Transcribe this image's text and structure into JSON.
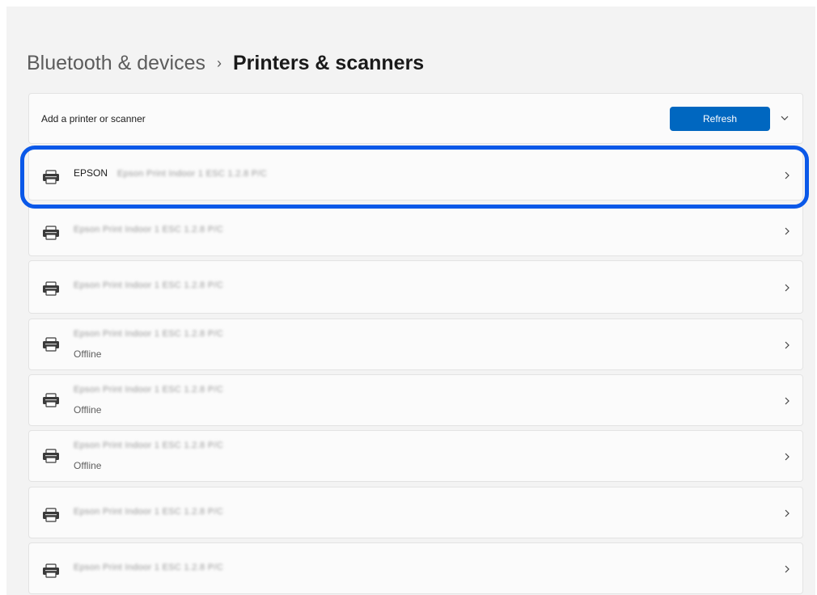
{
  "breadcrumb": {
    "parent": "Bluetooth & devices",
    "separator": "›",
    "current": "Printers & scanners"
  },
  "add_section": {
    "label": "Add a printer or scanner",
    "refresh_label": "Refresh",
    "expand_icon": "chevron-down-icon"
  },
  "printers": [
    {
      "brand": "EPSON",
      "name": "Epson Print Indoor 1 ESC 1.2.8 P/C",
      "status": "",
      "highlighted": true
    },
    {
      "brand": "",
      "name": "Epson Print Indoor 1 ESC 1.2.8 P/C",
      "status": ""
    },
    {
      "brand": "",
      "name": "Epson Print Indoor 1 ESC 1.2.8 P/C",
      "status": ""
    },
    {
      "brand": "",
      "name": "Epson Print Indoor 1 ESC 1.2.8 P/C",
      "status": "Offline"
    },
    {
      "brand": "",
      "name": "Epson Print Indoor 1 ESC 1.2.8 P/C",
      "status": "Offline"
    },
    {
      "brand": "",
      "name": "Epson Print Indoor 1 ESC 1.2.8 P/C",
      "status": "Offline"
    },
    {
      "brand": "",
      "name": "Epson Print Indoor 1 ESC 1.2.8 P/C",
      "status": ""
    },
    {
      "brand": "",
      "name": "Epson Print Indoor 1 ESC 1.2.8 P/C",
      "status": ""
    }
  ],
  "colors": {
    "accent": "#0067c0",
    "highlight_outline": "#0a58e8",
    "background": "#f3f3f3",
    "card": "#fbfbfb"
  }
}
